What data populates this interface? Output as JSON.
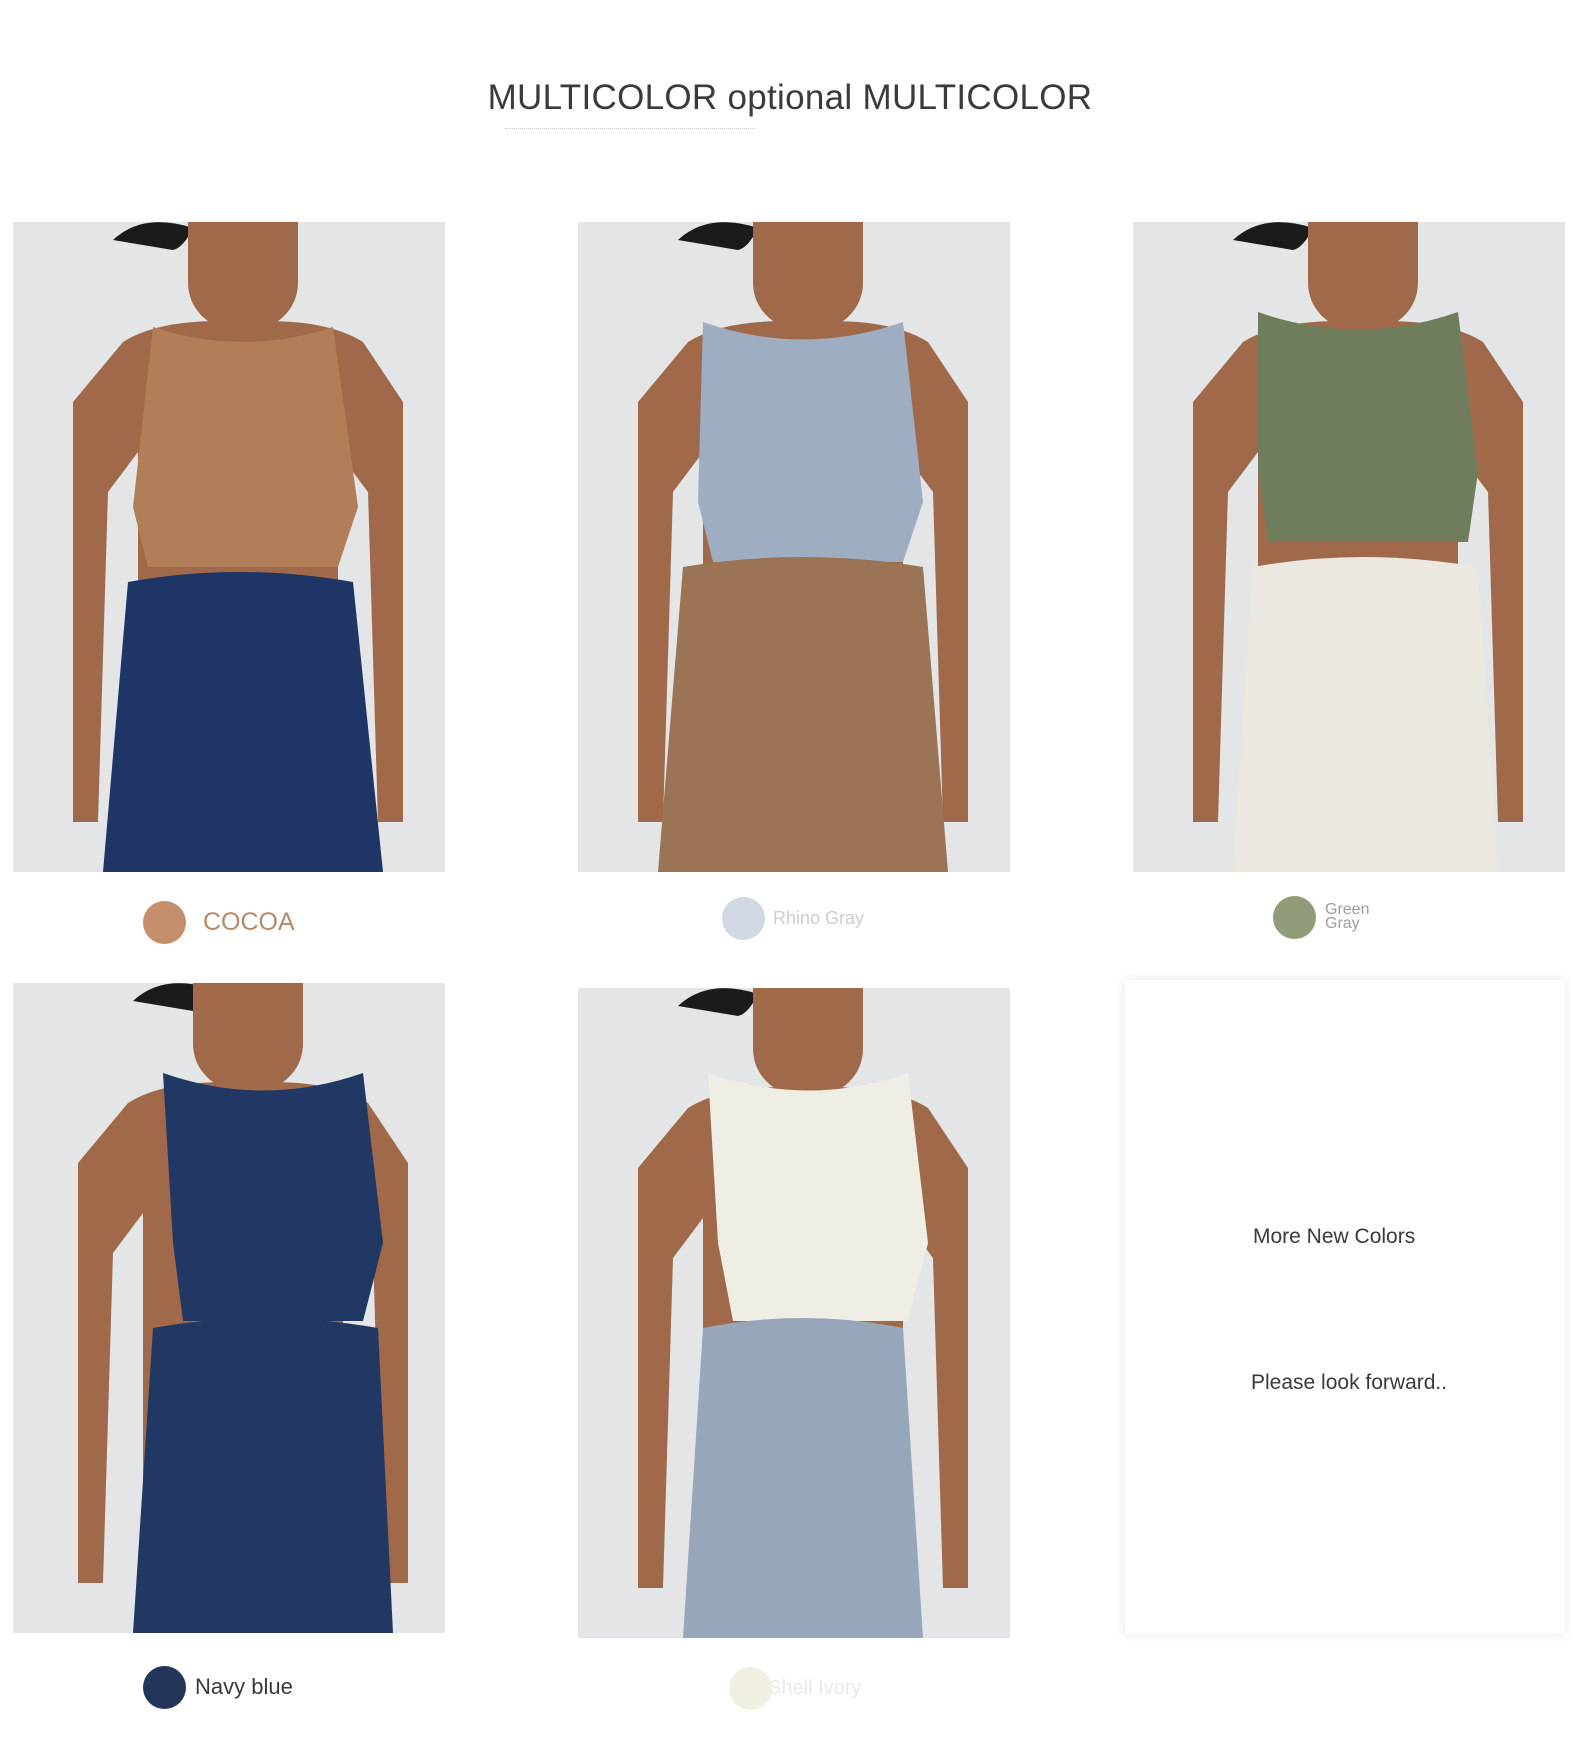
{
  "heading": "MULTICOLOR optional MULTICOLOR",
  "colors": {
    "skin": "#a06a4a",
    "hair": "#1b1b1b",
    "background": "#e4e5e6"
  },
  "products": [
    {
      "label": "COCOA",
      "swatch": "#c4906c",
      "label_color": "#b48a6a",
      "top_color": "#b27e58",
      "bottom_color": "#1f3566"
    },
    {
      "label": "Rhino Gray",
      "swatch": "#cfd8e3",
      "label_color": "#c9cdd3",
      "top_color": "#9eadc2",
      "bottom_color": "#9b7456"
    },
    {
      "label_line1": "Green",
      "label_line2": "Gray",
      "swatch": "#919c7a",
      "label_color": "#9aa197",
      "top_color": "#707d5c",
      "bottom_color": "#ebe9df"
    },
    {
      "label": "Navy blue",
      "swatch": "#233559",
      "label_color": "#3a3a3a",
      "top_color": "#223864",
      "bottom_color": "#223864"
    },
    {
      "label": "Shell Ivory",
      "swatch": "#f1efe3",
      "label_color": "#ebe9e1",
      "top_color": "#efeee4",
      "bottom_color": "#97a6b8"
    }
  ],
  "more_card": {
    "line1": "More New Colors",
    "line2": "Please look forward.."
  }
}
